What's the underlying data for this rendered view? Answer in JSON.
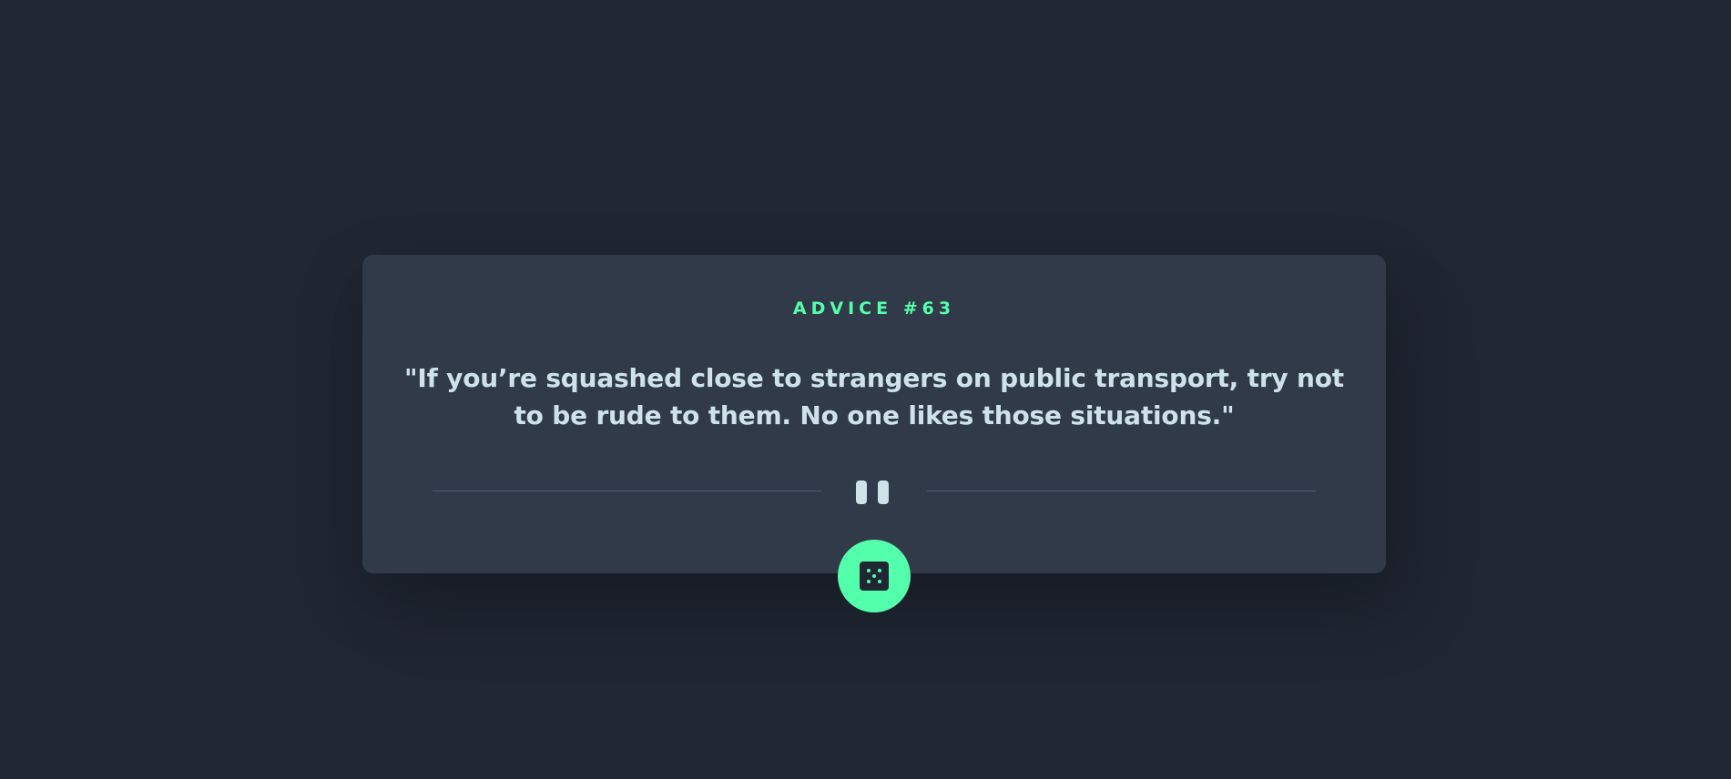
{
  "card": {
    "advice_label": "ADVICE #63",
    "advice_text": "\"If you’re squashed close to strangers on public transport, try not to be rude to them. No one likes those situations.\""
  },
  "icons": {
    "divider": "pause-icon",
    "button": "dice-icon"
  },
  "colors": {
    "background": "#202733",
    "card": "#313a48",
    "accent": "#53ffaa",
    "text": "#cee3e9",
    "divider": "#4f5d74"
  }
}
